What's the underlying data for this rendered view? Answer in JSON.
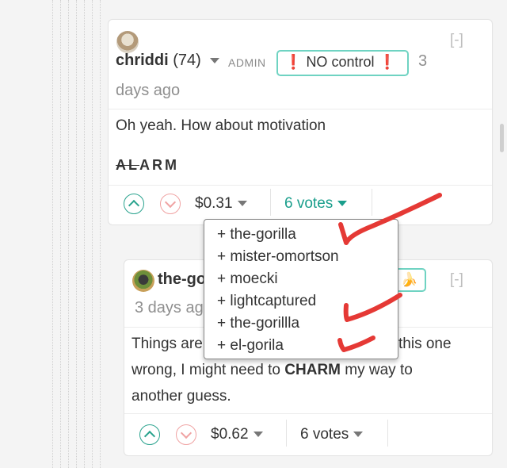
{
  "comment1": {
    "collapse": "[-]",
    "author": "chriddi",
    "reputation": "(74)",
    "role": "ADMIN",
    "badge": {
      "icon_left": "❗",
      "text": "NO control",
      "icon_right": "❗"
    },
    "time_part1": "3",
    "time_part2": "days ago",
    "body": "Oh yeah. How about motivation",
    "alarm_struck": "AL",
    "alarm_rest": "ARM",
    "payout": "$0.31",
    "votes": "6 votes"
  },
  "voters_dropdown": [
    "+ the-gorilla",
    "+ mister-omortson",
    "+ moecki",
    "+ lightcaptured",
    "+ the-gorillla",
    "+ el-gorila"
  ],
  "comment2": {
    "collapse": "[-]",
    "author_visible": "the-go",
    "time_visible": "3 days ag",
    "badge_icon": "🍌",
    "body_line1_start": "Things are",
    "body_line1_end": "this one",
    "body_line2_start": "wrong, I might need to ",
    "body_line2_bold": "CHARM",
    "body_line2_end": " my way to",
    "body_line3": "another guess.",
    "payout": "$0.62",
    "votes": "6 votes"
  },
  "colors": {
    "accent_teal": "#1a9e8c",
    "badge_border": "#6fd3c2",
    "annotation_red": "#e53935"
  },
  "icons": {
    "upvote": "chevron-up-circle-icon",
    "downvote": "chevron-down-circle-icon",
    "dropdown": "caret-down-icon",
    "warning": "exclamation-icon",
    "banana": "banana-icon"
  }
}
